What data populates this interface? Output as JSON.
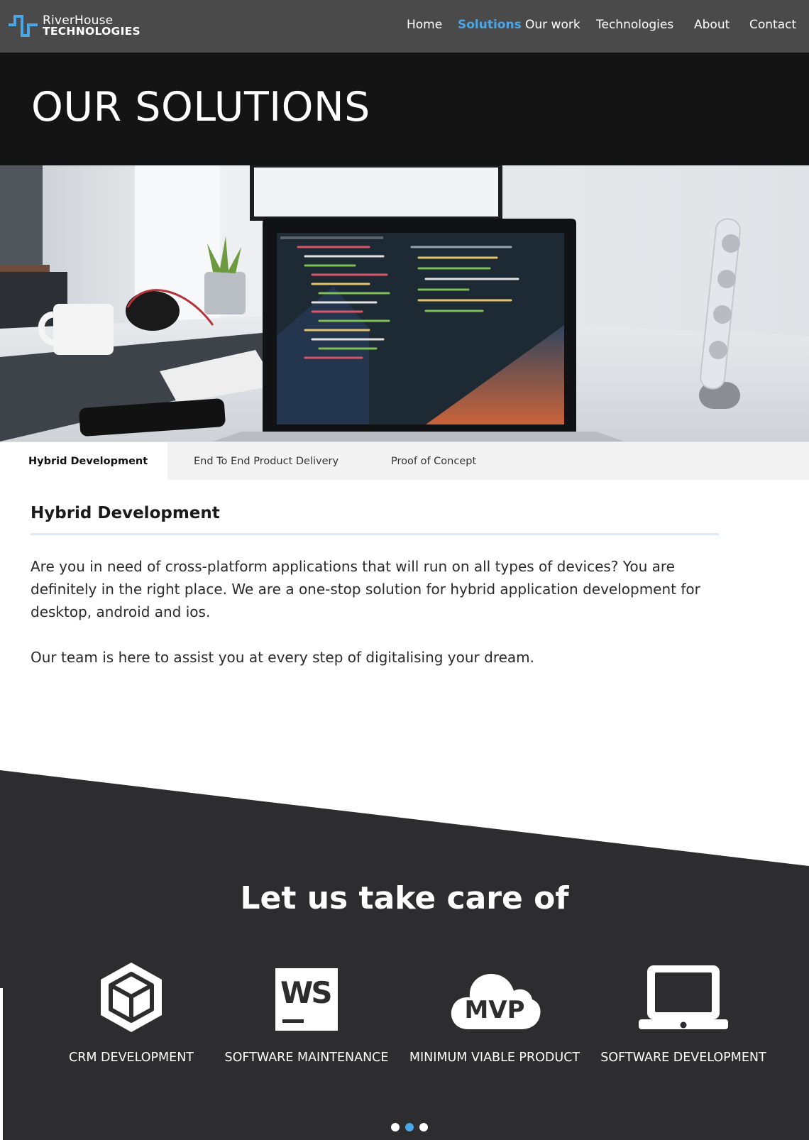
{
  "brand": {
    "name_line1": "RiverHouse",
    "name_line2": "TECHNOLOGIES",
    "accent_color": "#4aa6e6",
    "icon": "wave-logo-icon"
  },
  "nav": {
    "items": [
      {
        "label": "Home",
        "active": false
      },
      {
        "label": "Solutions",
        "active": true
      },
      {
        "label": "Our work",
        "active": false
      },
      {
        "label": "Technologies",
        "active": false
      },
      {
        "label": "About",
        "active": false
      },
      {
        "label": "Contact",
        "active": false
      }
    ]
  },
  "hero": {
    "title": "OUR SOLUTIONS"
  },
  "tabs": {
    "items": [
      {
        "label": "Hybrid Development",
        "active": true
      },
      {
        "label": "End To End Product Delivery",
        "active": false
      },
      {
        "label": "Proof of Concept",
        "active": false
      }
    ]
  },
  "content": {
    "heading": "Hybrid Development",
    "paragraph1": "Are you in need of cross-platform applications that will run on all types of devices? You are definitely in the right place. We are a one-stop solution for hybrid application development for desktop, android and ios.",
    "paragraph2": "Our team is here to assist you at every step of digitalising your dream."
  },
  "services": {
    "heading": "Let us take care of",
    "items": [
      {
        "label": "CRM DEVELOPMENT",
        "icon": "cube-icon"
      },
      {
        "label": "SOFTWARE MAINTENANCE",
        "icon": "ws-icon",
        "icon_text": "WS"
      },
      {
        "label": "MINIMUM VIABLE PRODUCT",
        "icon": "mvp-cloud-icon",
        "icon_text": "MVP"
      },
      {
        "label": "SOFTWARE DEVELOPMENT",
        "icon": "laptop-icon"
      }
    ],
    "carousel": {
      "pages": 3,
      "active_page": 2
    }
  },
  "colors": {
    "nav_bg": "#4a4a4a",
    "hero_bg": "#141414",
    "section_bg": "#2d2d2f"
  }
}
